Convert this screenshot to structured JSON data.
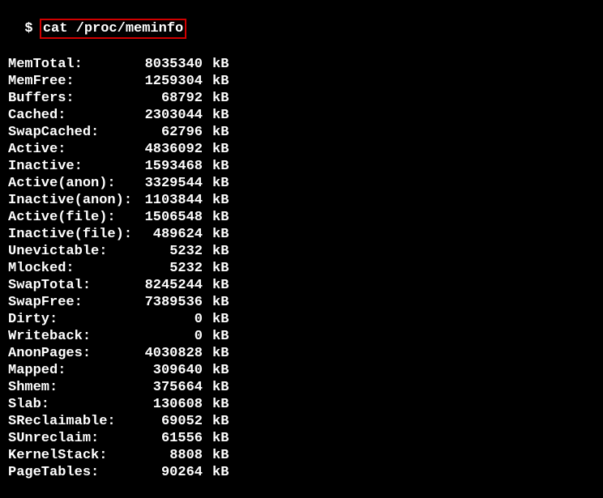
{
  "prompt": "$",
  "command": "cat /proc/meminfo",
  "unit": "kB",
  "rows": [
    {
      "label": "MemTotal:",
      "value": "8035340"
    },
    {
      "label": "MemFree:",
      "value": "1259304"
    },
    {
      "label": "Buffers:",
      "value": "68792"
    },
    {
      "label": "Cached:",
      "value": "2303044"
    },
    {
      "label": "SwapCached:",
      "value": "62796"
    },
    {
      "label": "Active:",
      "value": "4836092"
    },
    {
      "label": "Inactive:",
      "value": "1593468"
    },
    {
      "label": "Active(anon):",
      "value": "3329544"
    },
    {
      "label": "Inactive(anon):",
      "value": "1103844"
    },
    {
      "label": "Active(file):",
      "value": "1506548"
    },
    {
      "label": "Inactive(file):",
      "value": "489624"
    },
    {
      "label": "Unevictable:",
      "value": "5232"
    },
    {
      "label": "Mlocked:",
      "value": "5232"
    },
    {
      "label": "SwapTotal:",
      "value": "8245244"
    },
    {
      "label": "SwapFree:",
      "value": "7389536"
    },
    {
      "label": "Dirty:",
      "value": "0"
    },
    {
      "label": "Writeback:",
      "value": "0"
    },
    {
      "label": "AnonPages:",
      "value": "4030828"
    },
    {
      "label": "Mapped:",
      "value": "309640"
    },
    {
      "label": "Shmem:",
      "value": "375664"
    },
    {
      "label": "Slab:",
      "value": "130608"
    },
    {
      "label": "SReclaimable:",
      "value": "69052"
    },
    {
      "label": "SUnreclaim:",
      "value": "61556"
    },
    {
      "label": "KernelStack:",
      "value": "8808"
    },
    {
      "label": "PageTables:",
      "value": "90264"
    }
  ]
}
